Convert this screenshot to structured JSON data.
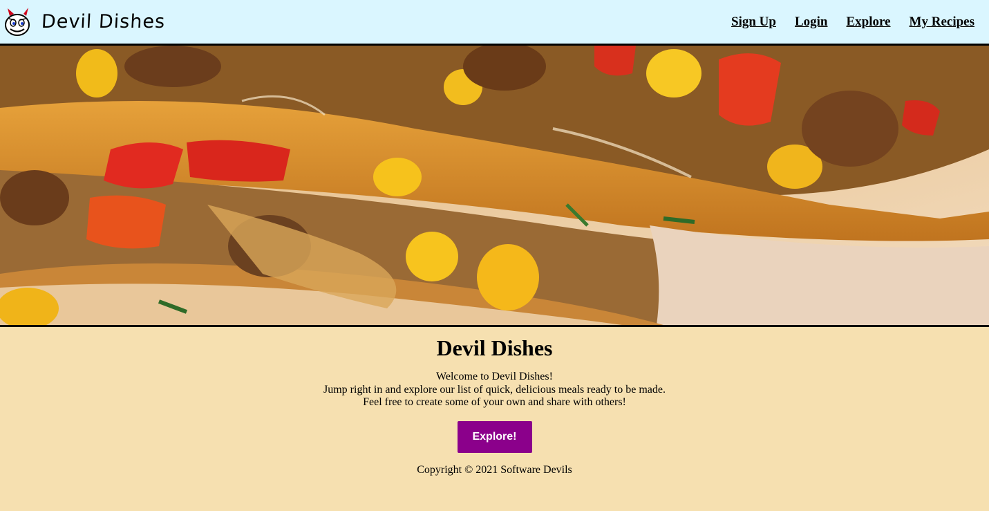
{
  "header": {
    "brand_name": "Devil Dishes",
    "logo_icon": "devil-face-logo-icon",
    "nav": [
      {
        "label": "Sign Up"
      },
      {
        "label": "Login"
      },
      {
        "label": "Explore"
      },
      {
        "label": "My Recipes"
      }
    ]
  },
  "hero": {
    "image": "quesadilla-banner-image"
  },
  "main": {
    "title": "Devil Dishes",
    "intro_lines": [
      "Welcome to Devil Dishes!",
      "Jump right in and explore our list of quick, delicious meals ready to be made.",
      "Feel free to create some of your own and share with others!"
    ],
    "cta_label": "Explore!"
  },
  "footer": {
    "copyright": "Copyright © 2021 Software Devils"
  },
  "colors": {
    "header_bg": "#daf6ff",
    "page_bg": "#f6e0b0",
    "button_bg": "#8b008b"
  }
}
